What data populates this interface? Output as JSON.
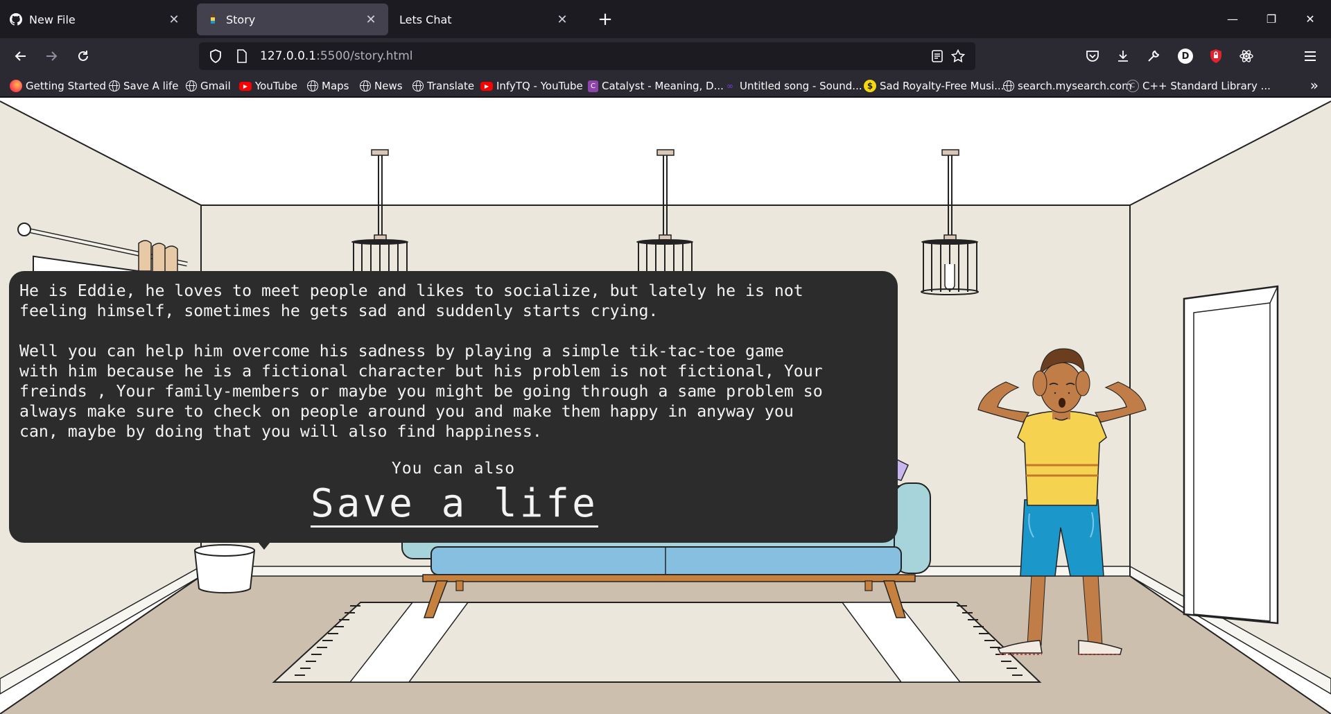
{
  "tabs": [
    {
      "title": "New File",
      "icon": "github-icon",
      "active": false
    },
    {
      "title": "Story",
      "icon": "person-favicon",
      "active": true
    },
    {
      "title": "Lets Chat",
      "icon": "",
      "active": false
    }
  ],
  "window_controls": {
    "minimize": "—",
    "restore": "❐",
    "close": "✕"
  },
  "navbar": {
    "url_host": "127.0.0.1",
    "url_path": ":5500/story.html"
  },
  "bookmarks": [
    {
      "label": "Getting Started",
      "icon": "firefox-icon"
    },
    {
      "label": "Save A life",
      "icon": "globe-icon"
    },
    {
      "label": "Gmail",
      "icon": "globe-icon"
    },
    {
      "label": "YouTube",
      "icon": "youtube-icon"
    },
    {
      "label": "Maps",
      "icon": "globe-icon"
    },
    {
      "label": "News",
      "icon": "globe-icon"
    },
    {
      "label": "Translate",
      "icon": "globe-icon"
    },
    {
      "label": "InfyTQ - YouTube",
      "icon": "youtube-icon"
    },
    {
      "label": "Catalyst - Meaning, D...",
      "icon": "catalyst-icon"
    },
    {
      "label": "Untitled song - Sound...",
      "icon": "soundtrap-icon"
    },
    {
      "label": "Sad Royalty-Free Musi...",
      "icon": "dollar-icon"
    },
    {
      "label": "search.mysearch.com",
      "icon": "globe-icon"
    },
    {
      "label": "C++ Standard Library ...",
      "icon": "cpp-icon"
    }
  ],
  "story": {
    "paragraph1_line1": "He is Eddie, he loves to meet people and likes to socialize, but lately he is not",
    "paragraph1_line2": "feeling himself, sometimes he gets sad and suddenly starts crying.",
    "paragraph2_line1": "Well you can help him overcome his sadness by playing a simple tik-tac-toe game",
    "paragraph2_line2": "with him because he is a fictional character but his problem is not fictional, Your",
    "paragraph2_line3": "freinds , Your family-members or maybe you might be going through a same problem so",
    "paragraph2_line4": "always make sure to check on people around you and make them happy in anyway you",
    "paragraph2_line5": "can, maybe by doing that you will also find happiness.",
    "also": "You can also",
    "cta": "Save a life"
  },
  "colors": {
    "wall": "#ebe7dc",
    "floor": "#cdbfad",
    "sofa": "#a7d3da",
    "bubble": "#2c2c2c",
    "shirt": "#f5d24f",
    "shorts": "#1b98c9",
    "skin": "#c17d48"
  }
}
